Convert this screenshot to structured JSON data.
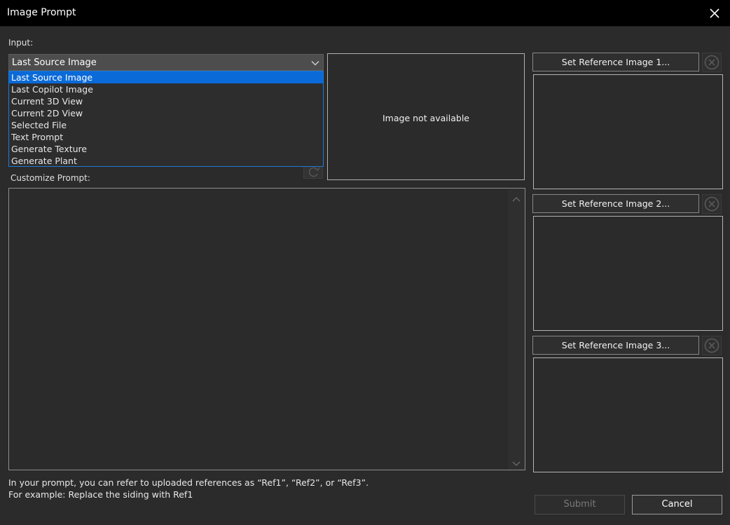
{
  "window": {
    "title": "Image Prompt",
    "close_icon": "close-icon"
  },
  "input": {
    "label": "Input:",
    "selected": "Last Source Image",
    "options": [
      "Last Source Image",
      "Last Copilot Image",
      "Current 3D View",
      "Current 2D View",
      "Selected File",
      "Text Prompt",
      "Generate Texture",
      "Generate Plant"
    ]
  },
  "preview": {
    "text": "Image not available"
  },
  "prompt": {
    "label": "Customize Prompt:",
    "value": ""
  },
  "references": [
    {
      "button_label": "Set Reference Image 1..."
    },
    {
      "button_label": "Set Reference Image 2..."
    },
    {
      "button_label": "Set Reference Image 3..."
    }
  ],
  "hint": {
    "line1": "In your prompt, you can refer to uploaded references as “Ref1”, “Ref2”, or “Ref3”.",
    "line2": "For example: Replace the siding with Ref1"
  },
  "actions": {
    "submit": "Submit",
    "cancel": "Cancel"
  },
  "colors": {
    "accent": "#0a6ad8",
    "background": "#2b2b2b",
    "titlebar": "#000000"
  }
}
